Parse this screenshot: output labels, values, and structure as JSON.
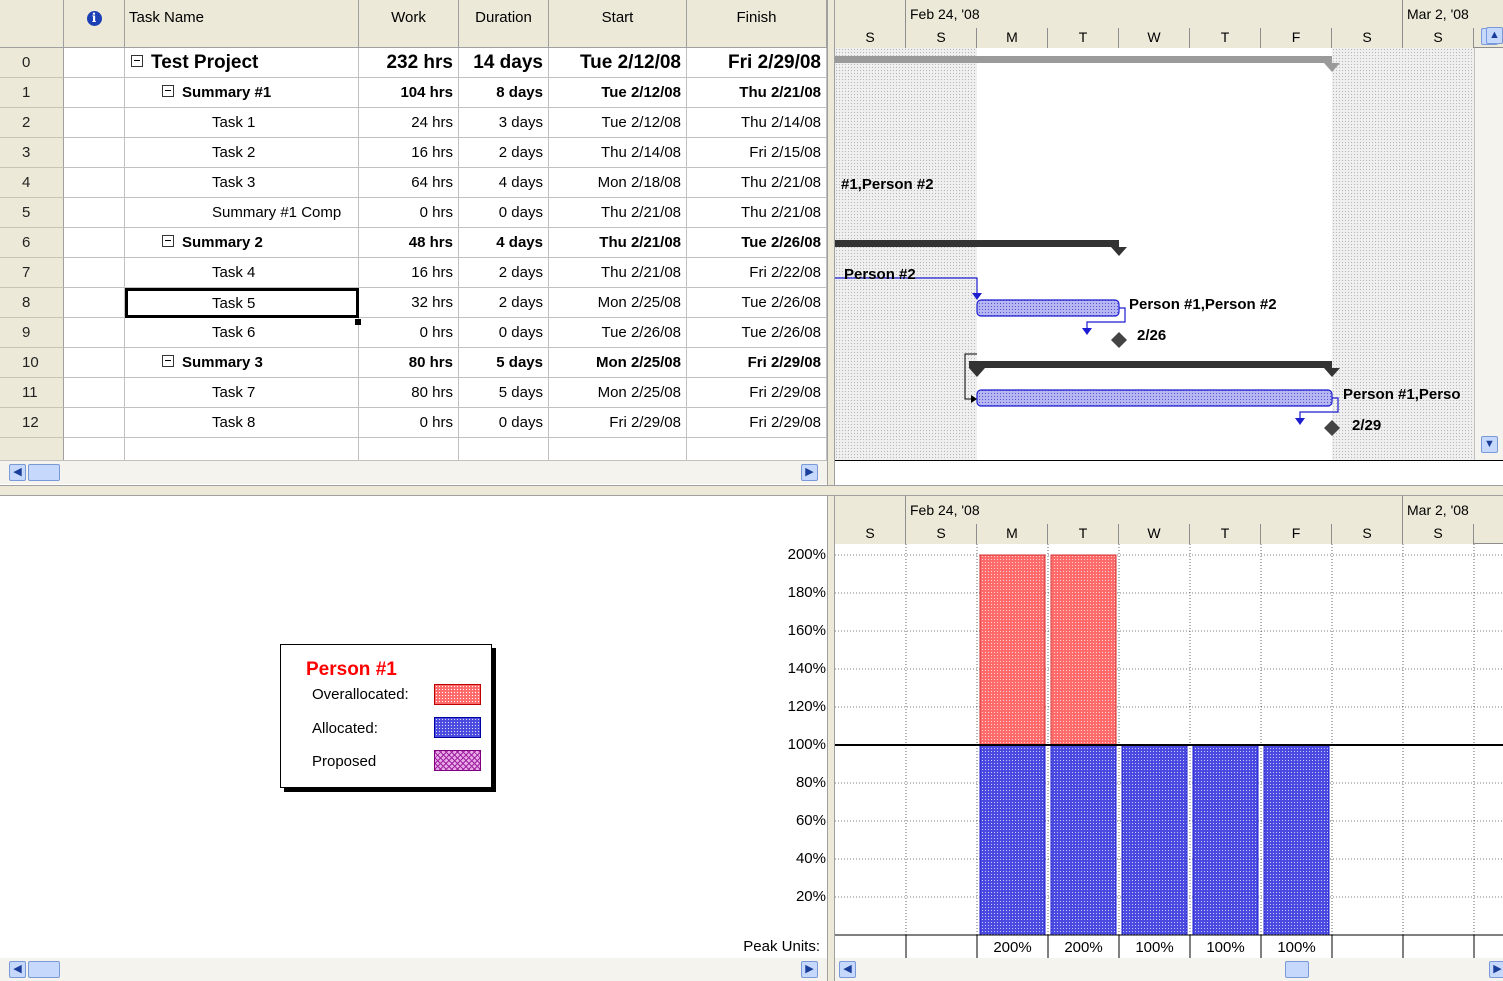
{
  "columns": {
    "indicators_icon": "info-icon",
    "task_name": "Task Name",
    "work": "Work",
    "duration": "Duration",
    "start": "Start",
    "finish": "Finish"
  },
  "tasks": [
    {
      "id": "0",
      "name": "Test Project",
      "work": "232 hrs",
      "duration": "14 days",
      "start": "Tue 2/12/08",
      "finish": "Fri 2/29/08",
      "level": 0,
      "summary": true
    },
    {
      "id": "1",
      "name": "Summary #1",
      "work": "104 hrs",
      "duration": "8 days",
      "start": "Tue 2/12/08",
      "finish": "Thu 2/21/08",
      "level": 1,
      "summary": true
    },
    {
      "id": "2",
      "name": "Task 1",
      "work": "24 hrs",
      "duration": "3 days",
      "start": "Tue 2/12/08",
      "finish": "Thu 2/14/08",
      "level": 2,
      "summary": false
    },
    {
      "id": "3",
      "name": "Task 2",
      "work": "16 hrs",
      "duration": "2 days",
      "start": "Thu 2/14/08",
      "finish": "Fri 2/15/08",
      "level": 2,
      "summary": false
    },
    {
      "id": "4",
      "name": "Task 3",
      "work": "64 hrs",
      "duration": "4 days",
      "start": "Mon 2/18/08",
      "finish": "Thu 2/21/08",
      "level": 2,
      "summary": false
    },
    {
      "id": "5",
      "name": "Summary #1 Comp",
      "work": "0 hrs",
      "duration": "0 days",
      "start": "Thu 2/21/08",
      "finish": "Thu 2/21/08",
      "level": 2,
      "summary": false
    },
    {
      "id": "6",
      "name": "Summary 2",
      "work": "48 hrs",
      "duration": "4 days",
      "start": "Thu 2/21/08",
      "finish": "Tue 2/26/08",
      "level": 1,
      "summary": true
    },
    {
      "id": "7",
      "name": "Task 4",
      "work": "16 hrs",
      "duration": "2 days",
      "start": "Thu 2/21/08",
      "finish": "Fri 2/22/08",
      "level": 2,
      "summary": false
    },
    {
      "id": "8",
      "name": "Task 5",
      "work": "32 hrs",
      "duration": "2 days",
      "start": "Mon 2/25/08",
      "finish": "Tue 2/26/08",
      "level": 2,
      "summary": false,
      "selected": true
    },
    {
      "id": "9",
      "name": "Task 6",
      "work": "0 hrs",
      "duration": "0 days",
      "start": "Tue 2/26/08",
      "finish": "Tue 2/26/08",
      "level": 2,
      "summary": false
    },
    {
      "id": "10",
      "name": "Summary 3",
      "work": "80 hrs",
      "duration": "5 days",
      "start": "Mon 2/25/08",
      "finish": "Fri 2/29/08",
      "level": 1,
      "summary": true
    },
    {
      "id": "11",
      "name": "Task 7",
      "work": "80 hrs",
      "duration": "5 days",
      "start": "Mon 2/25/08",
      "finish": "Fri 2/29/08",
      "level": 2,
      "summary": false
    },
    {
      "id": "12",
      "name": "Task 8",
      "work": "0 hrs",
      "duration": "0 days",
      "start": "Fri 2/29/08",
      "finish": "Fri 2/29/08",
      "level": 2,
      "summary": false
    }
  ],
  "timescale": {
    "week1": "Feb 24, '08",
    "week2": "Mar 2, '08",
    "days": [
      "S",
      "S",
      "M",
      "T",
      "W",
      "T",
      "F",
      "S",
      "S"
    ]
  },
  "gantt_labels": {
    "row4": "#1,Person #2",
    "row7": "Person #2",
    "row8": "Person #1,Person #2",
    "row9": "2/26",
    "row11": "Person #1,Perso",
    "row12": "2/29"
  },
  "legend": {
    "resource": "Person #1",
    "overallocated": "Overallocated:",
    "allocated": "Allocated:",
    "proposed": "Proposed"
  },
  "usage_axis": [
    "200%",
    "180%",
    "160%",
    "140%",
    "120%",
    "100%",
    "80%",
    "60%",
    "40%",
    "20%"
  ],
  "peak_units_label": "Peak Units:",
  "peak_units": [
    "",
    "",
    "200%",
    "200%",
    "100%",
    "100%",
    "100%",
    "",
    ""
  ],
  "colors": {
    "overallocated": "#ff6b6b",
    "allocated": "#4a4ae0",
    "proposed": "#c050c0",
    "legend_title": "#ff0000"
  },
  "chart_data": {
    "type": "bar",
    "categories": [
      "S",
      "S",
      "M",
      "T",
      "W",
      "T",
      "F",
      "S",
      "S"
    ],
    "series": [
      {
        "name": "Allocated:",
        "values": [
          0,
          0,
          100,
          100,
          100,
          100,
          100,
          0,
          0
        ]
      },
      {
        "name": "Overallocated:",
        "values": [
          0,
          0,
          100,
          100,
          0,
          0,
          0,
          0,
          0
        ]
      }
    ],
    "ylim": [
      0,
      200
    ],
    "grid": true
  }
}
